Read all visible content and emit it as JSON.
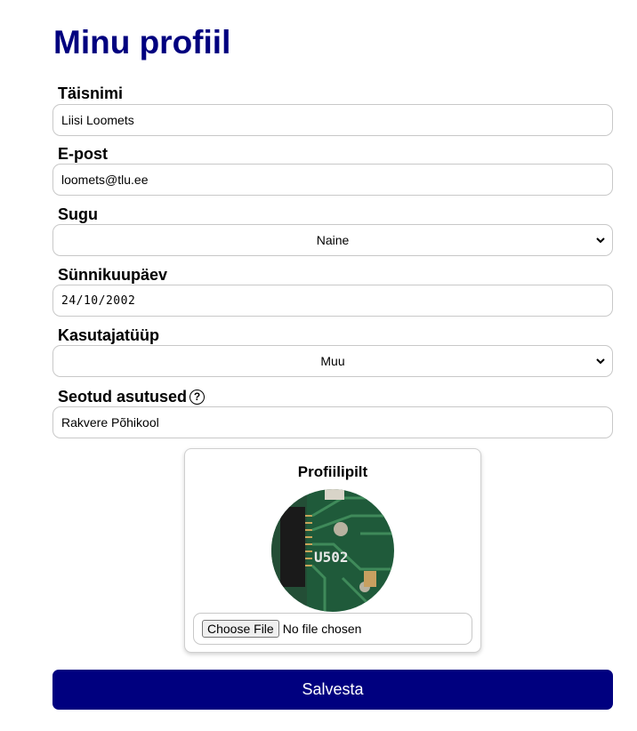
{
  "page_title": "Minu profiil",
  "fields": {
    "fullname": {
      "label": "Täisnimi",
      "value": "Liisi Loomets"
    },
    "email": {
      "label": "E-post",
      "value": "loomets@tlu.ee"
    },
    "gender": {
      "label": "Sugu",
      "value": "Naine"
    },
    "birthdate": {
      "label": "Sünnikuupäev",
      "value": "24/10/2002"
    },
    "user_type": {
      "label": "Kasutajatüüp",
      "value": "Muu"
    },
    "institutions": {
      "label": "Seotud asutused",
      "help_icon": "?",
      "value": "Rakvere Põhikool"
    }
  },
  "profile_picture": {
    "title": "Profiilipilt",
    "chip_text": "U502",
    "file_button": "Choose File",
    "file_status": "No file chosen"
  },
  "save_button": "Salvesta",
  "colors": {
    "primary": "#00007f"
  }
}
